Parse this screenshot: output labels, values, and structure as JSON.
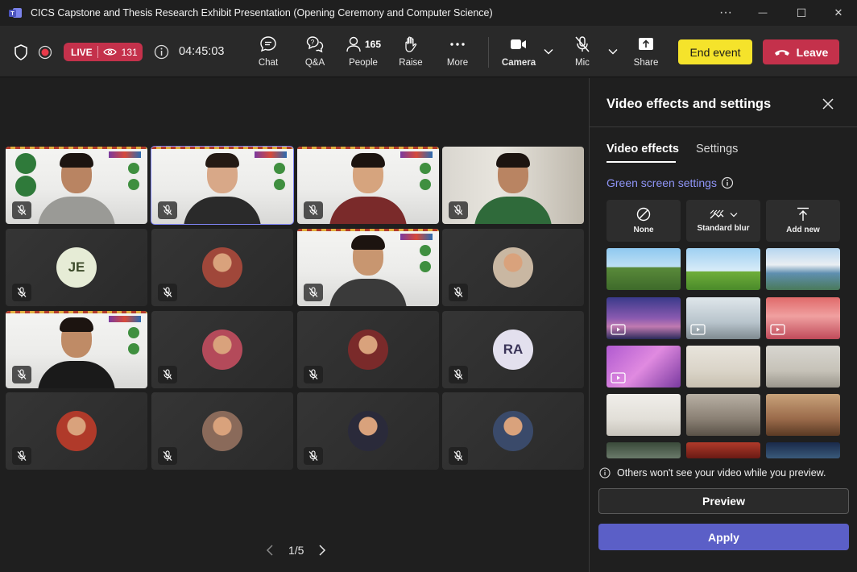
{
  "window": {
    "title": "CICS Capstone and Thesis Research Exhibit Presentation (Opening Ceremony and Computer Science)",
    "more_glyph": "···",
    "minimize_glyph": "—",
    "maximize_glyph": "☐",
    "close_glyph": "✕"
  },
  "toolbar": {
    "live_label": "LIVE",
    "viewer_count": "131",
    "elapsed_time": "04:45:03",
    "chat_label": "Chat",
    "qa_label": "Q&A",
    "people_label": "People",
    "people_count": "165",
    "raise_label": "Raise",
    "more_label": "More",
    "camera_label": "Camera",
    "mic_label": "Mic",
    "share_label": "Share",
    "end_event_label": "End event",
    "leave_label": "Leave"
  },
  "stage": {
    "participants": [
      {
        "kind": "video",
        "scene": "banner-man",
        "active": false
      },
      {
        "kind": "video",
        "scene": "banner-woman",
        "active": true
      },
      {
        "kind": "video",
        "scene": "banner-woman-glasses",
        "active": false
      },
      {
        "kind": "video",
        "scene": "room-man",
        "active": false
      },
      {
        "kind": "initials",
        "initials": "JE",
        "avatar_color": "#e6ecd6",
        "text_color": "#3c4a2a"
      },
      {
        "kind": "avatar",
        "avatar_color": "#a0473a"
      },
      {
        "kind": "video",
        "scene": "banner-man-glasses",
        "active": false
      },
      {
        "kind": "avatar",
        "avatar_color": "#c9b7a2"
      },
      {
        "kind": "video",
        "scene": "banner-man-dark",
        "active": false
      },
      {
        "kind": "avatar",
        "avatar_color": "#b44a5a"
      },
      {
        "kind": "avatar",
        "avatar_color": "#7a2a2a"
      },
      {
        "kind": "initials",
        "initials": "RA",
        "avatar_color": "#e3e0ee",
        "text_color": "#3a3458"
      },
      {
        "kind": "avatar",
        "avatar_color": "#b03a2a"
      },
      {
        "kind": "avatar",
        "avatar_color": "#8a6a5a"
      },
      {
        "kind": "avatar",
        "avatar_color": "#2a2a3a"
      },
      {
        "kind": "avatar",
        "avatar_color": "#3a4a6a"
      }
    ],
    "page_label": "1/5"
  },
  "panel": {
    "title": "Video effects and settings",
    "tabs": [
      "Video effects",
      "Settings"
    ],
    "selected_tab": "Video effects",
    "green_screen_link": "Green screen settings",
    "options": [
      {
        "label": "None",
        "icon": "none-icon"
      },
      {
        "label": "Standard blur",
        "icon": "blur-icon"
      },
      {
        "label": "Add new",
        "icon": "upload-icon"
      }
    ],
    "backgrounds": [
      {
        "name": "minecraft-portal-landscape",
        "video": false
      },
      {
        "name": "minecraft-bee",
        "video": false
      },
      {
        "name": "mountain-lake",
        "video": false
      },
      {
        "name": "purple-mountain-sky",
        "video": true
      },
      {
        "name": "white-bubbles",
        "video": true
      },
      {
        "name": "red-clouds",
        "video": true
      },
      {
        "name": "pink-crystals",
        "video": true
      },
      {
        "name": "minimal-room",
        "video": false
      },
      {
        "name": "bright-loft",
        "video": false
      },
      {
        "name": "white-arch-room",
        "video": false
      },
      {
        "name": "concrete-lounge",
        "video": false
      },
      {
        "name": "warm-dining-room",
        "video": false
      },
      {
        "name": "forest-cabin",
        "video": false
      },
      {
        "name": "red-venue",
        "video": false
      },
      {
        "name": "night-sky",
        "video": false
      }
    ],
    "preview_note": "Others won't see your video while you preview.",
    "preview_label": "Preview",
    "apply_label": "Apply"
  },
  "colors": {
    "accent": "#5b5fc7",
    "link": "#8f95f7",
    "live": "#c4314b",
    "end_event": "#f5e32b",
    "leave": "#c4314b"
  }
}
